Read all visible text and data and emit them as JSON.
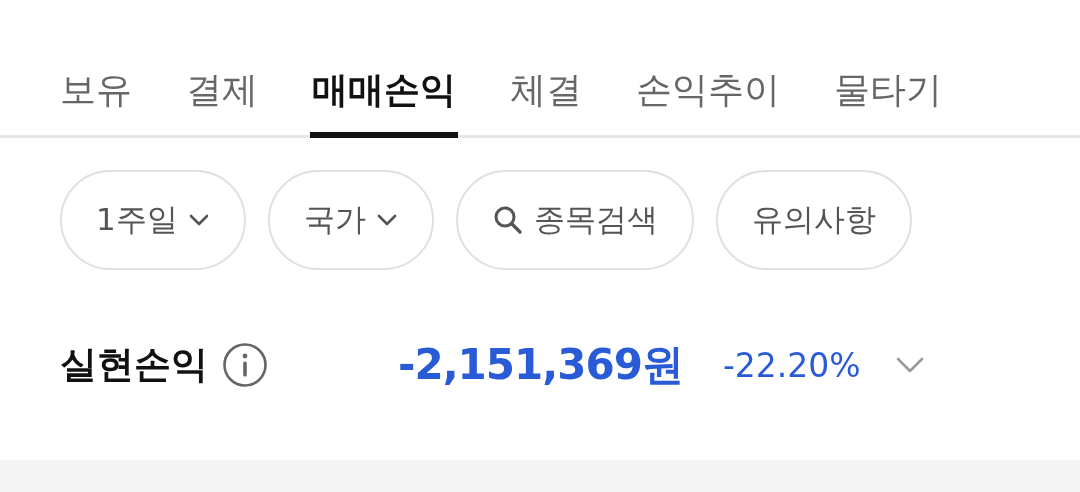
{
  "tabs": [
    {
      "label": "보유",
      "selected": false
    },
    {
      "label": "결제",
      "selected": false
    },
    {
      "label": "매매손익",
      "selected": true
    },
    {
      "label": "체결",
      "selected": false
    },
    {
      "label": "손익추이",
      "selected": false
    },
    {
      "label": "물타기",
      "selected": false
    }
  ],
  "filters": [
    {
      "kind": "dropdown",
      "label": "1주일"
    },
    {
      "kind": "dropdown",
      "label": "국가"
    },
    {
      "kind": "search",
      "label": "종목검색"
    },
    {
      "kind": "plain",
      "label": "유의사항"
    }
  ],
  "summary": {
    "label": "실현손익",
    "amount": "-2,151,369원",
    "percent": "-22.20%",
    "expanded": false
  }
}
